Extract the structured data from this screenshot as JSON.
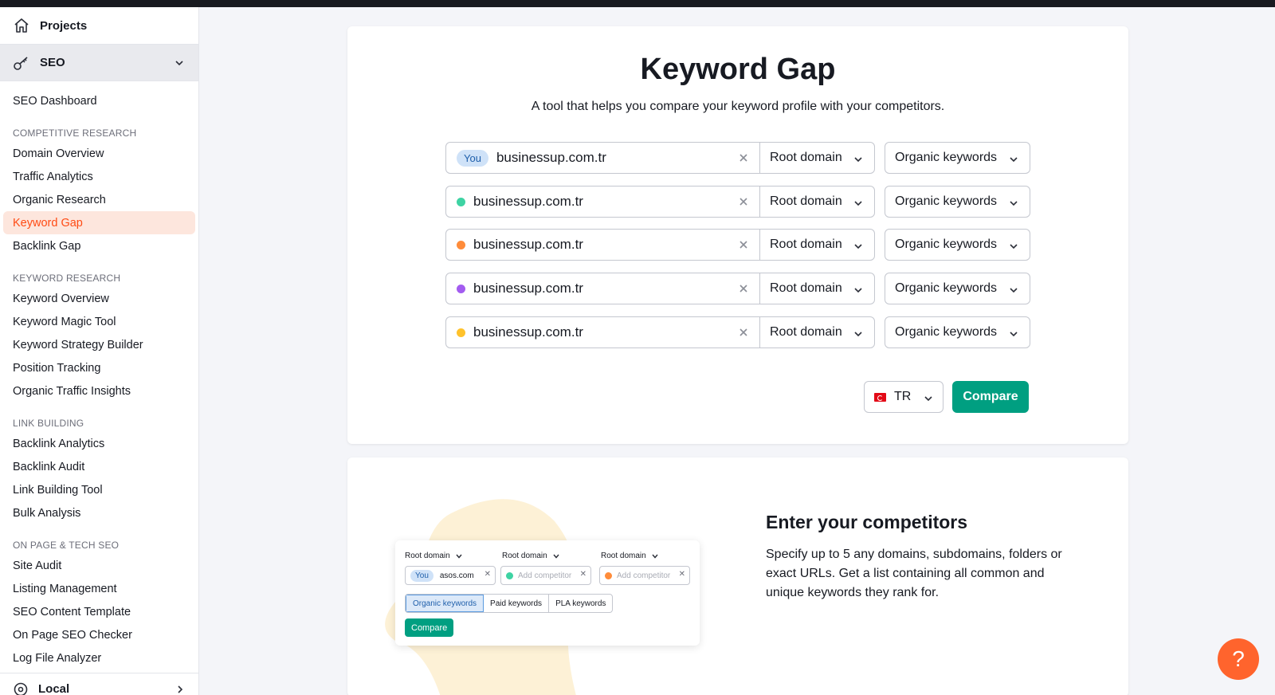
{
  "sidebar": {
    "projects_label": "Projects",
    "seo_label": "SEO",
    "dashboard": "SEO Dashboard",
    "sections": [
      {
        "title": "COMPETITIVE RESEARCH",
        "items": [
          "Domain Overview",
          "Traffic Analytics",
          "Organic Research",
          "Keyword Gap",
          "Backlink Gap"
        ]
      },
      {
        "title": "KEYWORD RESEARCH",
        "items": [
          "Keyword Overview",
          "Keyword Magic Tool",
          "Keyword Strategy Builder",
          "Position Tracking",
          "Organic Traffic Insights"
        ]
      },
      {
        "title": "LINK BUILDING",
        "items": [
          "Backlink Analytics",
          "Backlink Audit",
          "Link Building Tool",
          "Bulk Analysis"
        ]
      },
      {
        "title": "ON PAGE & TECH SEO",
        "items": [
          "Site Audit",
          "Listing Management",
          "SEO Content Template",
          "On Page SEO Checker",
          "Log File Analyzer"
        ]
      }
    ],
    "active_item": "Keyword Gap",
    "local_label": "Local"
  },
  "main": {
    "title": "Keyword Gap",
    "subtitle": "A tool that helps you compare your keyword profile with your competitors.",
    "you_badge": "You",
    "rows": [
      {
        "domain": "businessup.com.tr",
        "dot_color": "",
        "scope": "Root domain",
        "keyword_type": "Organic keywords"
      },
      {
        "domain": "businessup.com.tr",
        "dot_color": "#3ed3a3",
        "scope": "Root domain",
        "keyword_type": "Organic keywords"
      },
      {
        "domain": "businessup.com.tr",
        "dot_color": "#ff8c3a",
        "scope": "Root domain",
        "keyword_type": "Organic keywords"
      },
      {
        "domain": "businessup.com.tr",
        "dot_color": "#a35cf0",
        "scope": "Root domain",
        "keyword_type": "Organic keywords"
      },
      {
        "domain": "businessup.com.tr",
        "dot_color": "#ffc22b",
        "scope": "Root domain",
        "keyword_type": "Organic keywords"
      }
    ],
    "country": "TR",
    "compare_label": "Compare"
  },
  "info": {
    "title": "Enter your competitors",
    "text": "Specify up to 5 any domains, subdomains, folders or exact URLs. Get a list containing all common and unique keywords they rank for.",
    "mini": {
      "scope_labels": [
        "Root domain",
        "Root domain",
        "Root domain"
      ],
      "you": "You",
      "you_domain": "asos.com",
      "placeholder": "Add competitor",
      "tabs": [
        "Organic keywords",
        "Paid keywords",
        "PLA keywords"
      ],
      "compare": "Compare"
    }
  },
  "help_label": "?",
  "colors": {
    "accent_orange": "#ff4b14",
    "compare_green": "#009f81",
    "help_orange": "#ff642d"
  }
}
